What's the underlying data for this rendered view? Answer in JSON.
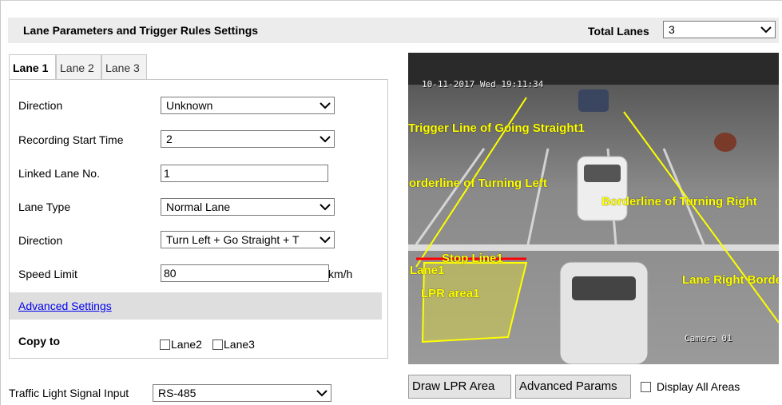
{
  "header": {
    "title": "Lane Parameters and Trigger Rules Settings",
    "total_lanes_label": "Total Lanes",
    "total_lanes_value": "3"
  },
  "tabs": [
    {
      "label": "Lane 1",
      "active": true
    },
    {
      "label": "Lane 2",
      "active": false
    },
    {
      "label": "Lane 3",
      "active": false
    }
  ],
  "form": {
    "direction": {
      "label": "Direction",
      "value": "Unknown"
    },
    "recording_start_time": {
      "label": "Recording Start Time",
      "value": "2"
    },
    "linked_lane_no": {
      "label": "Linked Lane No.",
      "value": "1"
    },
    "lane_type": {
      "label": "Lane Type",
      "value": "Normal Lane"
    },
    "direction2": {
      "label": "Direction",
      "value": "Turn Left + Go Straight + T"
    },
    "speed_limit": {
      "label": "Speed Limit",
      "value": "80",
      "unit": "km/h"
    },
    "advanced_settings_link": "Advanced Settings",
    "copy_to": {
      "label": "Copy to",
      "options": [
        {
          "label": "Lane2",
          "checked": false
        },
        {
          "label": "Lane3",
          "checked": false
        }
      ]
    }
  },
  "traffic_light": {
    "label": "Traffic Light Signal Input",
    "value": "RS-485"
  },
  "video": {
    "timestamp": "10-11-2017 Wed 19:11:34",
    "camera": "Camera 01",
    "overlay_color": "#ffff00",
    "stop_line_color": "#ff0000",
    "labels": {
      "trigger_line": "Trigger Line of Going Straight1",
      "borderline_left": "Borderline of Turning Left",
      "borderline_right": "Borderline of Turning Right",
      "stop_line": "Stop Line1",
      "lane_left": "Lane1",
      "lpr_area": "LPR area1",
      "lane_right": "Lane Right Border"
    }
  },
  "buttons": {
    "draw_lpr_area": "Draw LPR Area",
    "advanced_params": "Advanced Params",
    "display_all_areas": {
      "label": "Display All Areas",
      "checked": false
    }
  }
}
